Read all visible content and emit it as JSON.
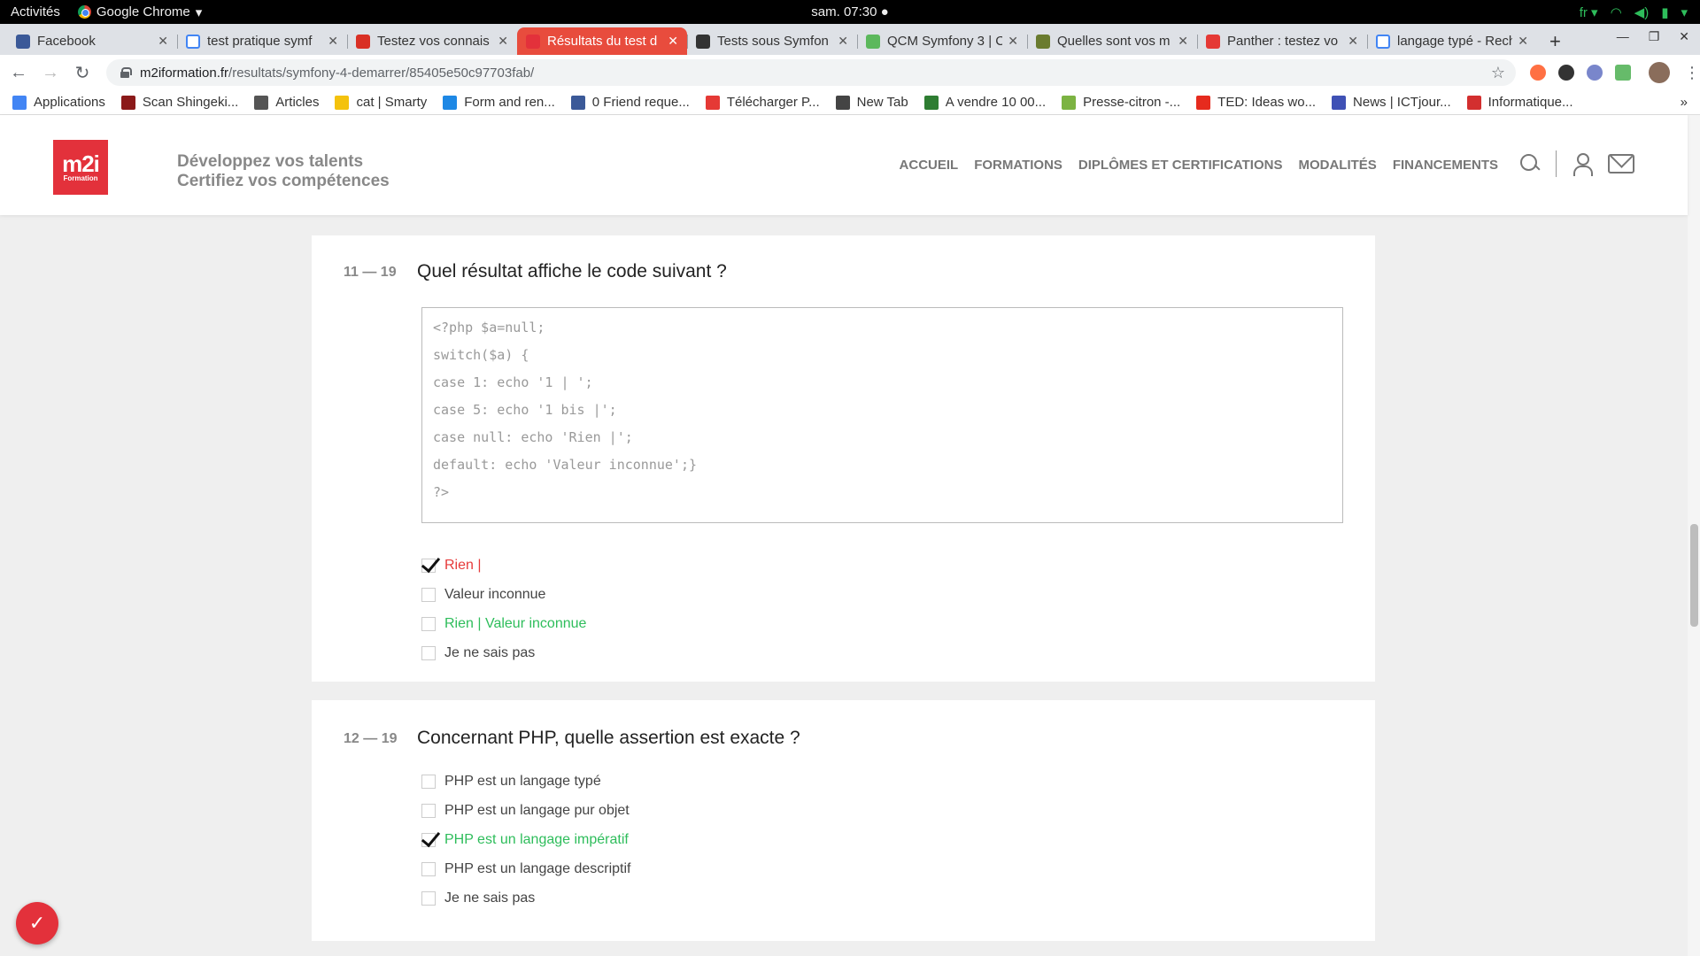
{
  "system": {
    "activities": "Activités",
    "app_name": "Google Chrome",
    "clock": "sam. 07:30",
    "lang": "fr"
  },
  "tabs": [
    {
      "title": "Facebook",
      "color": "#3b5998",
      "icon": "facebook-icon"
    },
    {
      "title": "test pratique symf",
      "color": "#ffffff",
      "icon": "google-icon"
    },
    {
      "title": "Testez vos connais",
      "color": "#d93025",
      "icon": "site-icon"
    },
    {
      "title": "Résultats du test d",
      "color": "#e3313b",
      "icon": "m2i-icon",
      "active": true
    },
    {
      "title": "Tests sous Symfon",
      "color": "#333333",
      "icon": "symfony-icon"
    },
    {
      "title": "QCM Symfony 3 | C",
      "color": "#5cb85c",
      "icon": "qcm-icon"
    },
    {
      "title": "Quelles sont vos m",
      "color": "#6a7b2f",
      "icon": "site-icon"
    },
    {
      "title": "Panther : testez vo",
      "color": "#e53935",
      "icon": "panther-icon"
    },
    {
      "title": "langage typé - Rech",
      "color": "#ffffff",
      "icon": "google-icon"
    }
  ],
  "address": {
    "host": "m2iformation.fr",
    "path": "/resultats/symfony-4-demarrer/85405e50c97703fab/"
  },
  "bookmarks": [
    {
      "label": "Applications",
      "color": "#4285f4"
    },
    {
      "label": "Scan Shingeki...",
      "color": "#8b1a1a"
    },
    {
      "label": "Articles",
      "color": "#555555"
    },
    {
      "label": "cat | Smarty",
      "color": "#f4c20d"
    },
    {
      "label": "Form and ren...",
      "color": "#1e88e5"
    },
    {
      "label": "0 Friend reque...",
      "color": "#3b5998"
    },
    {
      "label": "Télécharger P...",
      "color": "#e53935"
    },
    {
      "label": "New Tab",
      "color": "#444444"
    },
    {
      "label": "A vendre 10 00...",
      "color": "#2e7d32"
    },
    {
      "label": "Presse-citron -...",
      "color": "#7cb342"
    },
    {
      "label": "TED: Ideas wo...",
      "color": "#e62b1e"
    },
    {
      "label": "News | ICTjour...",
      "color": "#3f51b5"
    },
    {
      "label": "Informatique...",
      "color": "#d32f2f"
    }
  ],
  "site": {
    "logo_text": "m2i",
    "logo_sub": "Formation",
    "tagline1": "Développez vos talents",
    "tagline2": "Certifiez vos compétences",
    "nav": [
      "ACCUEIL",
      "FORMATIONS",
      "DIPLÔMES ET CERTIFICATIONS",
      "MODALITÉS",
      "FINANCEMENTS"
    ]
  },
  "questions": [
    {
      "num": "11 — 19",
      "text": "Quel résultat affiche le code suivant ?",
      "code": [
        "<?php $a=null;",
        "switch($a) {",
        "case 1: echo '1 | ';",
        "case 5: echo '1 bis |';",
        "case null: echo 'Rien |';",
        "default: echo 'Valeur inconnue';}",
        "?>"
      ],
      "answers": [
        {
          "label": "Rien |",
          "checked": true,
          "state": "wrong"
        },
        {
          "label": "Valeur inconnue",
          "checked": false,
          "state": "neutral"
        },
        {
          "label": "Rien | Valeur inconnue",
          "checked": false,
          "state": "right"
        },
        {
          "label": "Je ne sais pas",
          "checked": false,
          "state": "neutral"
        }
      ]
    },
    {
      "num": "12 — 19",
      "text": "Concernant PHP, quelle assertion est exacte ?",
      "answers": [
        {
          "label": "PHP est un langage typé",
          "checked": false,
          "state": "neutral"
        },
        {
          "label": "PHP est un langage pur objet",
          "checked": false,
          "state": "neutral"
        },
        {
          "label": "PHP est un langage impératif",
          "checked": true,
          "state": "right"
        },
        {
          "label": "PHP est un langage descriptif",
          "checked": false,
          "state": "neutral"
        },
        {
          "label": "Je ne sais pas",
          "checked": false,
          "state": "neutral"
        }
      ]
    }
  ],
  "colors": {
    "brand": "#e3313b",
    "wrong": "#e63a3a",
    "right": "#2ebd5b"
  }
}
